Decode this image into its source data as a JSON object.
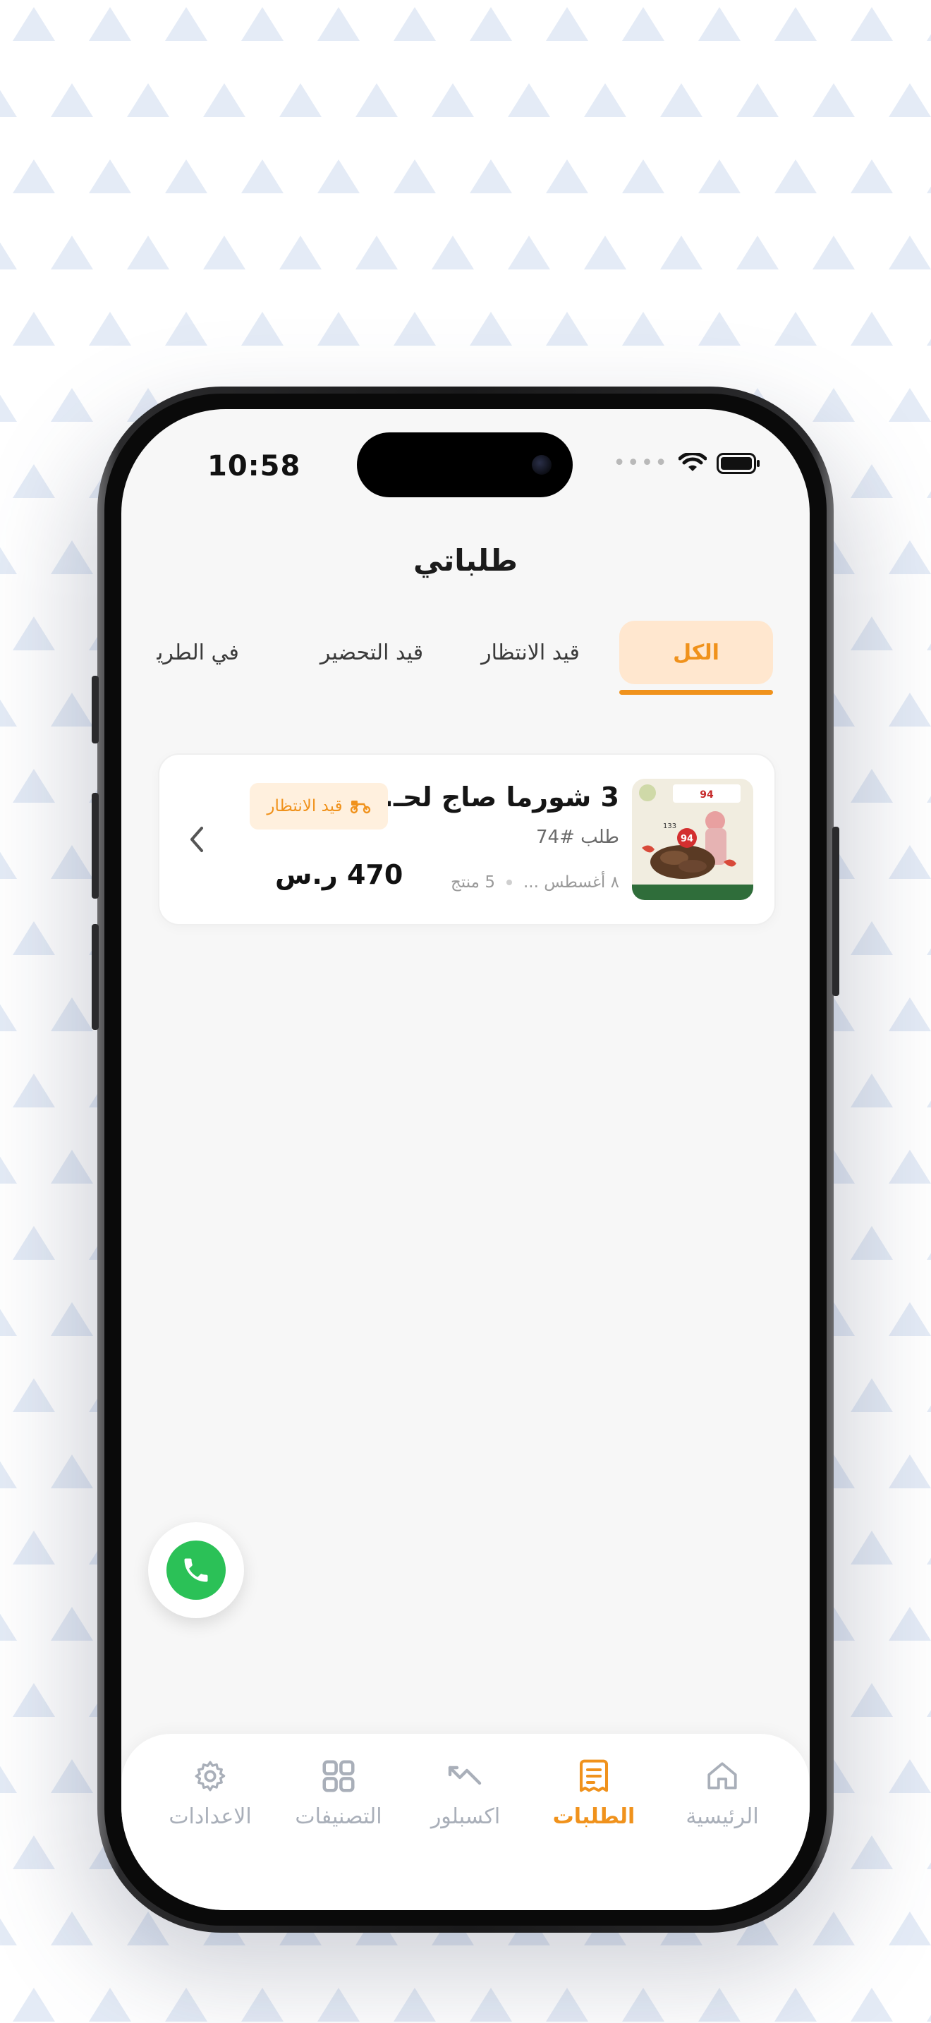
{
  "status_bar": {
    "time": "10:58"
  },
  "header": {
    "title": "طلباتي"
  },
  "tabs": [
    {
      "label": "الكل",
      "active": true
    },
    {
      "label": "قيد الانتظار",
      "active": false
    },
    {
      "label": "قيد التحضير",
      "active": false
    },
    {
      "label": "في الطريق",
      "active": false
    }
  ],
  "order": {
    "title": "3 شورما صاج لحـ...",
    "number": "طلب #74",
    "date": "٨ أغسطس ...",
    "items_count": "5 منتج",
    "status": "قيد الانتظار",
    "price": "470 ر.س",
    "thumb_price": "94",
    "thumb_small": "133"
  },
  "bottom_nav": [
    {
      "label": "الرئيسية",
      "icon": "home-icon",
      "active": false
    },
    {
      "label": "الطلبات",
      "icon": "orders-icon",
      "active": true
    },
    {
      "label": "اكسبلور",
      "icon": "explore-icon",
      "active": false
    },
    {
      "label": "التصنيفات",
      "icon": "categories-icon",
      "active": false
    },
    {
      "label": "الاعدادات",
      "icon": "settings-icon",
      "active": false
    }
  ],
  "colors": {
    "accent": "#f0921c",
    "accent_bg": "#ffe7cf",
    "call": "#2bc157",
    "pattern": "#e4ebf6"
  }
}
